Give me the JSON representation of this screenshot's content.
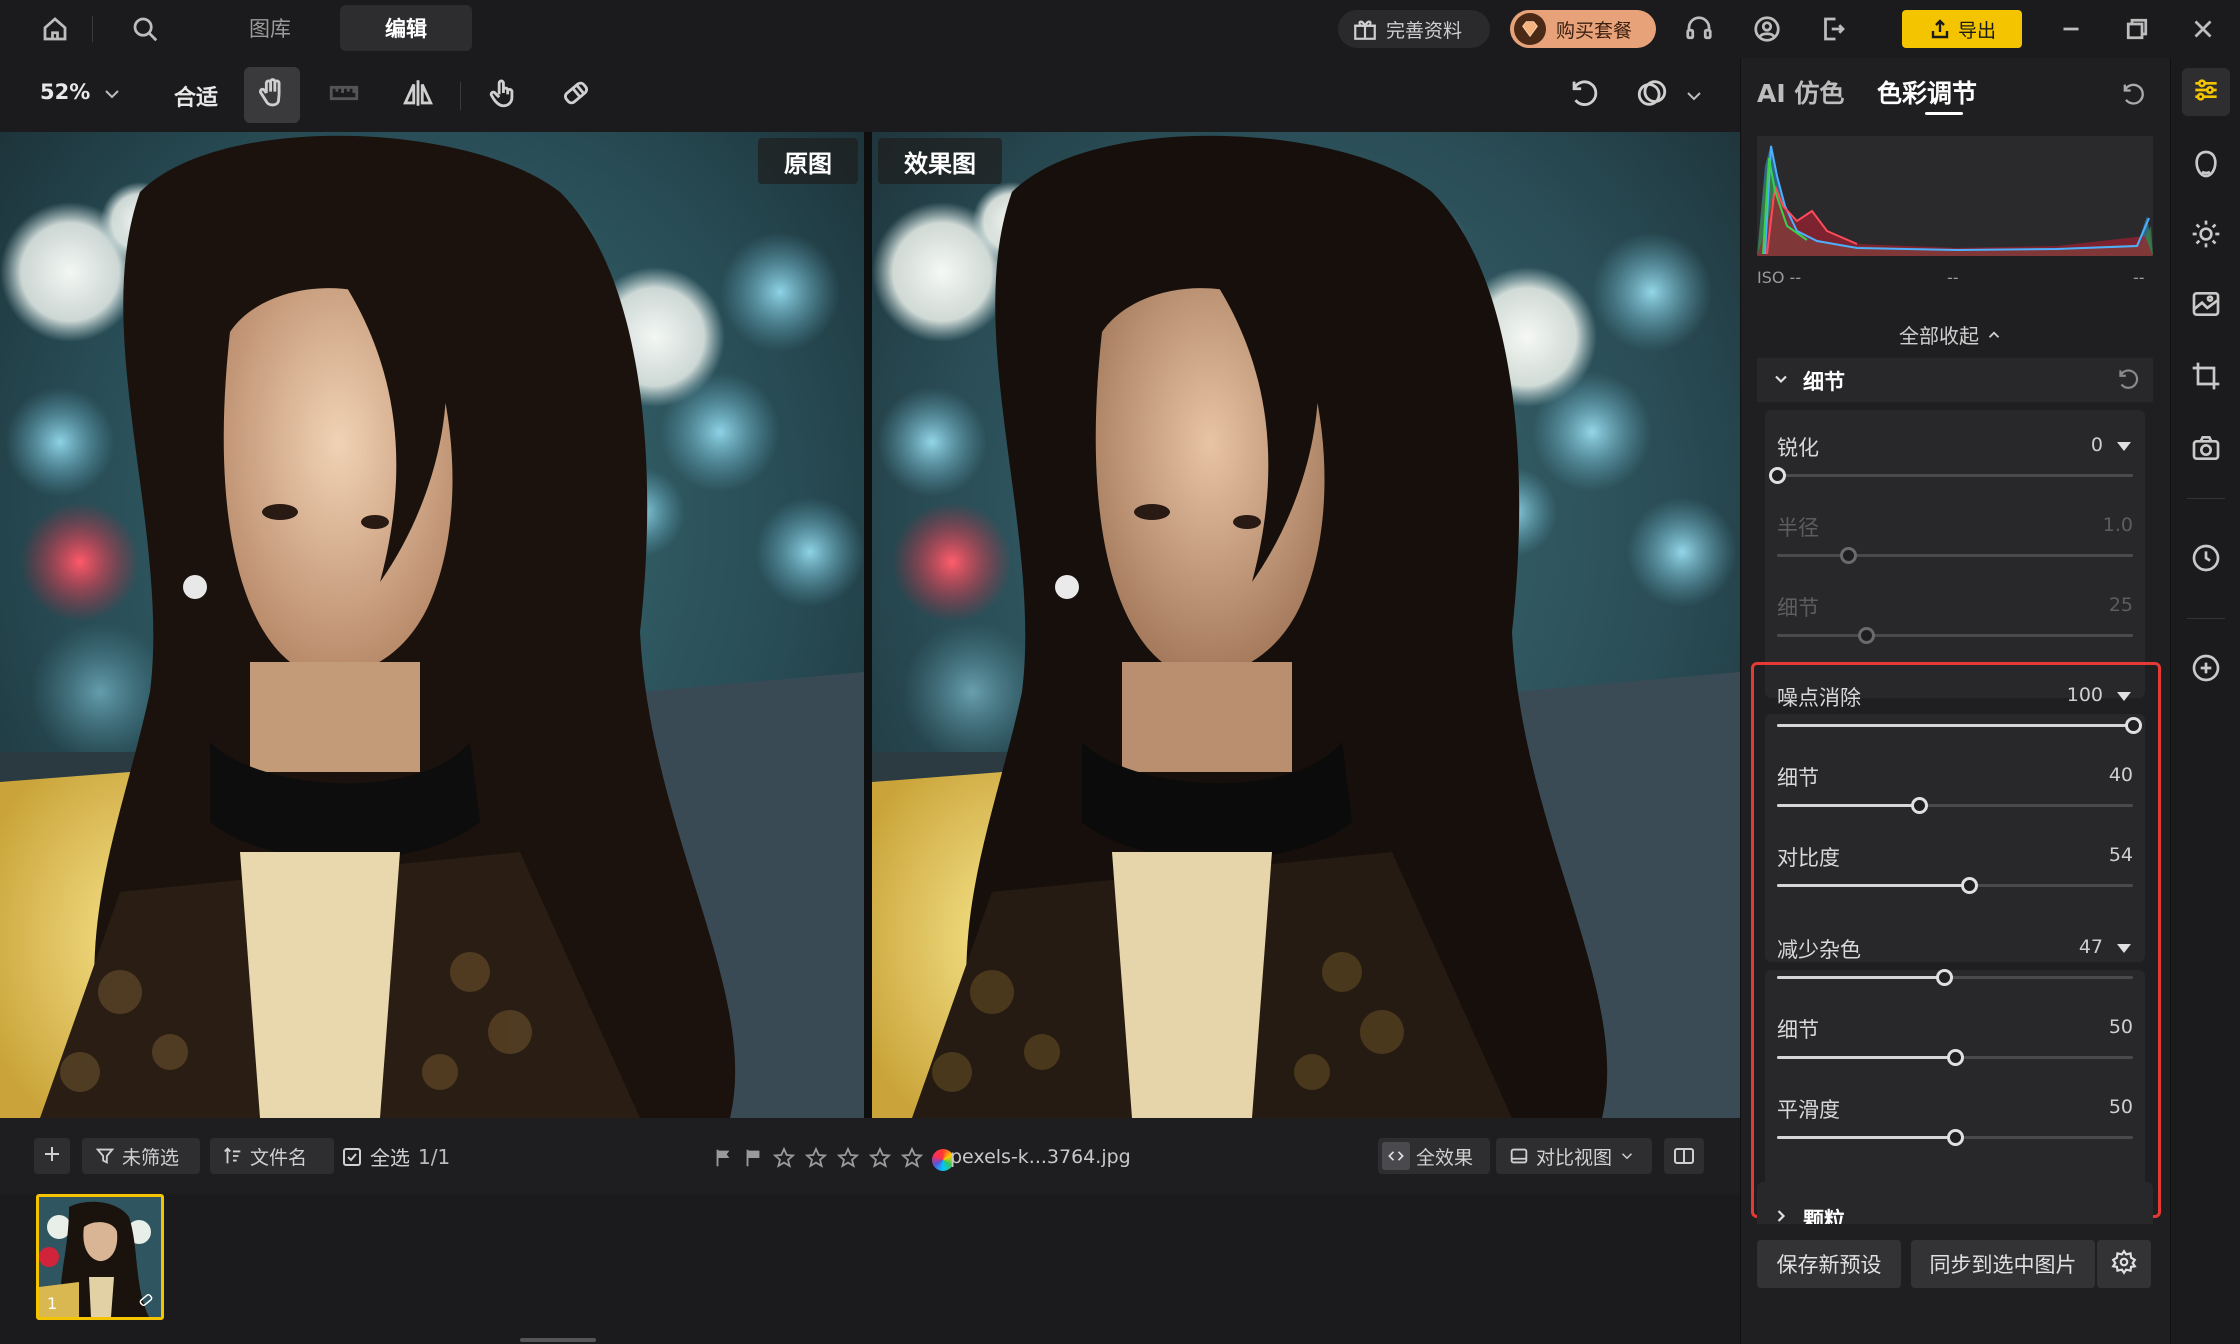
{
  "top_nav": {
    "tabs": [
      {
        "label": "图库"
      },
      {
        "label": "编辑"
      }
    ],
    "complete_profile": "完善资料",
    "buy_package": "购买套餐",
    "export": "导出"
  },
  "toolbar": {
    "zoom": "52%",
    "fit": "合适"
  },
  "canvas": {
    "original_label": "原图",
    "effect_label": "效果图"
  },
  "filmstrip_bar": {
    "filter": "未筛选",
    "sort": "文件名",
    "select_all": "全选",
    "count": "1/1",
    "filename": "pexels-k...3764.jpg",
    "all_effects": "全效果",
    "compare_view": "对比视图",
    "thumb_index": "1"
  },
  "panel": {
    "tabs": [
      {
        "label": "AI 仿色"
      },
      {
        "label": "色彩调节"
      }
    ],
    "active_tab": 1,
    "histogram": {
      "iso": "ISO --",
      "mid": "--",
      "right": "--"
    },
    "collapse_all": "全部收起",
    "detail_section": "细节",
    "sharpen": {
      "label": "锐化",
      "value": "0",
      "pct": 0
    },
    "radius": {
      "label": "半径",
      "value": "1.0",
      "pct": 20
    },
    "sharpen_detail": {
      "label": "细节",
      "value": "25",
      "pct": 25
    },
    "noise_reduction": {
      "label": "噪点消除",
      "value": "100",
      "pct": 100
    },
    "nr_detail": {
      "label": "细节",
      "value": "40",
      "pct": 40
    },
    "nr_contrast": {
      "label": "对比度",
      "value": "54",
      "pct": 54
    },
    "color_noise": {
      "label": "减少杂色",
      "value": "47",
      "pct": 47
    },
    "cn_detail": {
      "label": "细节",
      "value": "50",
      "pct": 50
    },
    "cn_smooth": {
      "label": "平滑度",
      "value": "50",
      "pct": 50
    },
    "grain_section": "颗粒",
    "save_preset": "保存新预设",
    "sync": "同步到选中图片"
  },
  "colors": {
    "accent_yellow": "#f5c400",
    "highlight_red": "#e53935",
    "buy_orange": "#e8a27a"
  },
  "icons": [
    "home-icon",
    "search-icon",
    "gift-icon",
    "diamond-icon",
    "headset-icon",
    "user-icon",
    "logout-icon",
    "upload-icon",
    "minimize-icon",
    "restore-icon",
    "close-icon",
    "chevron-down-icon",
    "hand-icon",
    "ruler-icon",
    "flip-icon",
    "touch-icon",
    "eraser-icon",
    "undo-icon",
    "overlay-icon",
    "plus-icon",
    "filter-icon",
    "sort-icon",
    "checkbox-icon",
    "flag-icon",
    "star-icon",
    "color-wheel-icon",
    "compare-icon",
    "split-icon",
    "reset-icon",
    "settings-icon",
    "sliders-icon",
    "face-icon",
    "sun-icon",
    "image-edit-icon",
    "crop-icon",
    "camera-icon",
    "history-icon",
    "add-circle-icon"
  ]
}
